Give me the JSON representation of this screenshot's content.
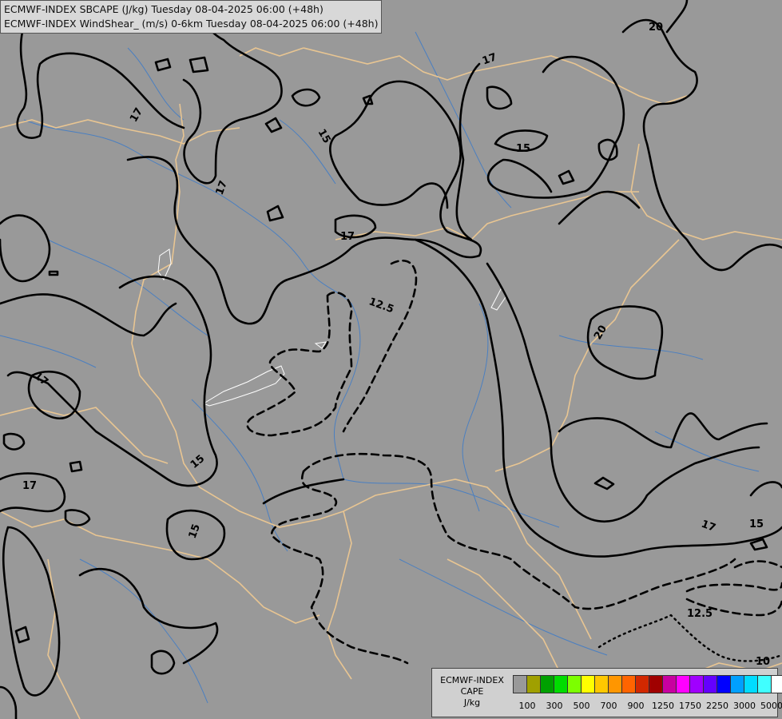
{
  "header": {
    "line1": "ECMWF-INDEX SBCAPE (J/kg) Tuesday 08-04-2025 06:00 (+48h)",
    "line2": "ECMWF-INDEX WindShear_ (m/s) 0-6km Tuesday 08-04-2025 06:00 (+48h)"
  },
  "contour_labels": [
    "20",
    "17",
    "17",
    "15",
    "15",
    "17",
    "17",
    "12.5",
    "20",
    "17",
    "15",
    "17",
    "15",
    "17",
    "15",
    "12.5",
    "10"
  ],
  "legend": {
    "title_line1": "ECMWF-INDEX",
    "title_line2": "CAPE",
    "title_line3": "J/kg",
    "colors": [
      "#999999",
      "#a0a000",
      "#00a000",
      "#00dc00",
      "#7cff00",
      "#ffff00",
      "#ffc800",
      "#ff9600",
      "#ff6400",
      "#d22800",
      "#a00000",
      "#c800a0",
      "#ff00ff",
      "#a000ff",
      "#6400ff",
      "#0000ff",
      "#00a0ff",
      "#00dcff",
      "#40ffff",
      "#ffffff"
    ],
    "ticks": [
      "100",
      "300",
      "500",
      "700",
      "900",
      "1250",
      "1750",
      "2250",
      "3000",
      "5000"
    ]
  }
}
